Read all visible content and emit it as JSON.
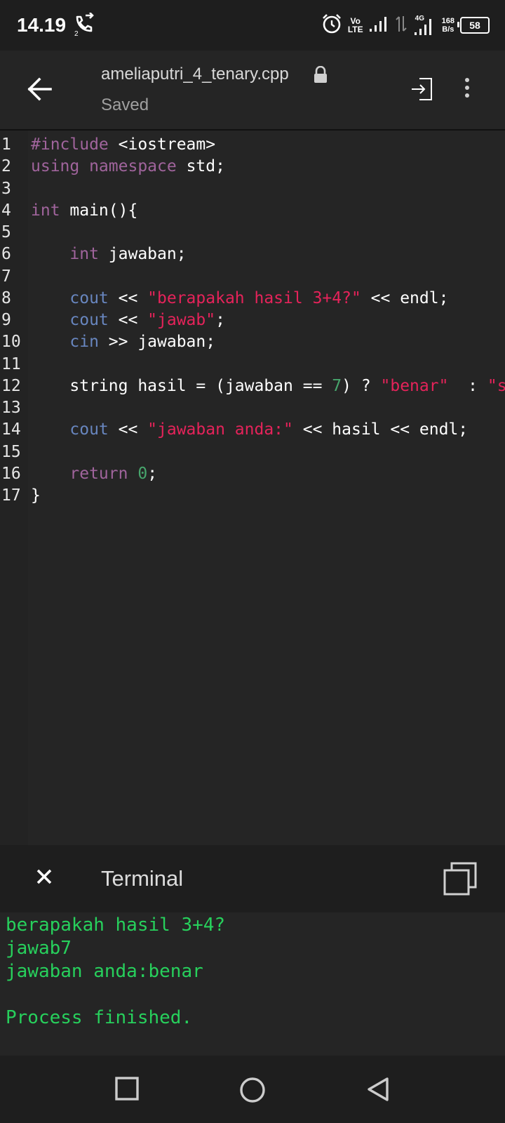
{
  "status_bar": {
    "time": "14.19",
    "call_sub": "2",
    "volte_top": "Vo",
    "volte_bottom": "LTE",
    "net_4g": "4G",
    "speed_value": "168",
    "speed_unit": "B/s",
    "battery": "58"
  },
  "header": {
    "filename": "ameliaputri_4_tenary.cpp",
    "status": "Saved"
  },
  "colors": {
    "keyword": "#a0649c",
    "stream": "#6886bf",
    "string": "#e5235a",
    "number": "#47a56c",
    "text": "#ffffff",
    "terminal_text": "#27d05c"
  },
  "editor": {
    "lines": [
      {
        "n": "1",
        "tokens": [
          {
            "t": "#include",
            "c": "keyword"
          },
          {
            "t": " <iostream>",
            "c": "text"
          }
        ]
      },
      {
        "n": "2",
        "tokens": [
          {
            "t": "using namespace",
            "c": "keyword"
          },
          {
            "t": " std;",
            "c": "text"
          }
        ]
      },
      {
        "n": "3",
        "tokens": []
      },
      {
        "n": "4",
        "tokens": [
          {
            "t": "int",
            "c": "keyword"
          },
          {
            "t": " main(){",
            "c": "text"
          }
        ]
      },
      {
        "n": "5",
        "tokens": []
      },
      {
        "n": "6",
        "tokens": [
          {
            "t": "    ",
            "c": "text"
          },
          {
            "t": "int",
            "c": "keyword"
          },
          {
            "t": " jawaban;",
            "c": "text"
          }
        ]
      },
      {
        "n": "7",
        "tokens": []
      },
      {
        "n": "8",
        "tokens": [
          {
            "t": "    ",
            "c": "text"
          },
          {
            "t": "cout",
            "c": "stream"
          },
          {
            "t": " << ",
            "c": "text"
          },
          {
            "t": "\"berapakah hasil 3+4?\"",
            "c": "string"
          },
          {
            "t": " << endl;",
            "c": "text"
          }
        ]
      },
      {
        "n": "9",
        "tokens": [
          {
            "t": "    ",
            "c": "text"
          },
          {
            "t": "cout",
            "c": "stream"
          },
          {
            "t": " << ",
            "c": "text"
          },
          {
            "t": "\"jawab\"",
            "c": "string"
          },
          {
            "t": ";",
            "c": "text"
          }
        ]
      },
      {
        "n": "10",
        "tokens": [
          {
            "t": "    ",
            "c": "text"
          },
          {
            "t": "cin",
            "c": "stream"
          },
          {
            "t": " >> jawaban;",
            "c": "text"
          }
        ]
      },
      {
        "n": "11",
        "tokens": []
      },
      {
        "n": "12",
        "tokens": [
          {
            "t": "    string hasil = (jawaban == ",
            "c": "text"
          },
          {
            "t": "7",
            "c": "number"
          },
          {
            "t": ") ? ",
            "c": "text"
          },
          {
            "t": "\"benar\"",
            "c": "string"
          },
          {
            "t": "  : ",
            "c": "text"
          },
          {
            "t": "\"s",
            "c": "string"
          }
        ]
      },
      {
        "n": "13",
        "tokens": []
      },
      {
        "n": "14",
        "tokens": [
          {
            "t": "    ",
            "c": "text"
          },
          {
            "t": "cout",
            "c": "stream"
          },
          {
            "t": " << ",
            "c": "text"
          },
          {
            "t": "\"jawaban anda:\"",
            "c": "string"
          },
          {
            "t": " << hasil << endl;",
            "c": "text"
          }
        ]
      },
      {
        "n": "15",
        "tokens": []
      },
      {
        "n": "16",
        "tokens": [
          {
            "t": "    ",
            "c": "text"
          },
          {
            "t": "return",
            "c": "keyword"
          },
          {
            "t": " ",
            "c": "text"
          },
          {
            "t": "0",
            "c": "number"
          },
          {
            "t": ";",
            "c": "text"
          }
        ]
      },
      {
        "n": "17",
        "tokens": [
          {
            "t": "}",
            "c": "text"
          }
        ]
      }
    ]
  },
  "terminal": {
    "title": "Terminal",
    "output": [
      "berapakah hasil 3+4?",
      "jawab7",
      "jawaban anda:benar",
      "",
      "Process finished."
    ]
  }
}
